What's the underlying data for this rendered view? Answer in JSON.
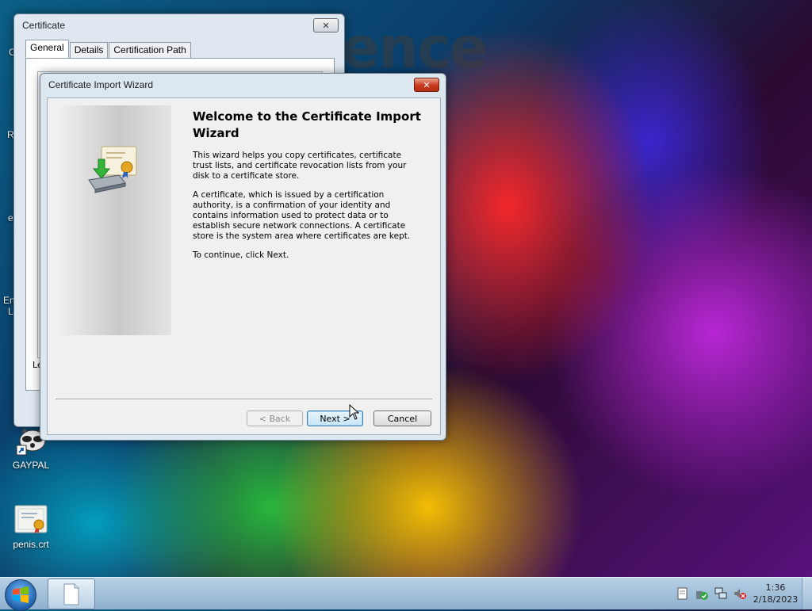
{
  "desktop": {
    "brand_text": "ence",
    "edge_letters": [
      "C",
      "R",
      "e",
      "En",
      "L"
    ],
    "icons": [
      {
        "label": "GAYPAL",
        "icon": "raccoon-shortcut-icon"
      },
      {
        "label": "penis.crt",
        "icon": "certificate-file-icon"
      }
    ]
  },
  "certificate_window": {
    "title": "Certificate",
    "tabs": [
      "General",
      "Details",
      "Certification Path"
    ],
    "active_tab": "General",
    "body_fragment": "Le"
  },
  "wizard": {
    "title": "Certificate Import Wizard",
    "heading": "Welcome to the Certificate Import Wizard",
    "paragraphs": [
      "This wizard helps you copy certificates, certificate trust lists, and certificate revocation lists from your disk to a certificate store.",
      "A certificate, which is issued by a certification authority, is a confirmation of your identity and contains information used to protect data or to establish secure network connections. A certificate store is the system area where certificates are kept.",
      "To continue, click Next."
    ],
    "buttons": {
      "back": "< Back",
      "next": "Next >",
      "cancel": "Cancel"
    }
  },
  "taskbar": {
    "clock_time": "1:36",
    "clock_date": "2/18/2023"
  },
  "colors": {
    "accent": "#3c7fb1",
    "close_red": "#c83a1e"
  }
}
